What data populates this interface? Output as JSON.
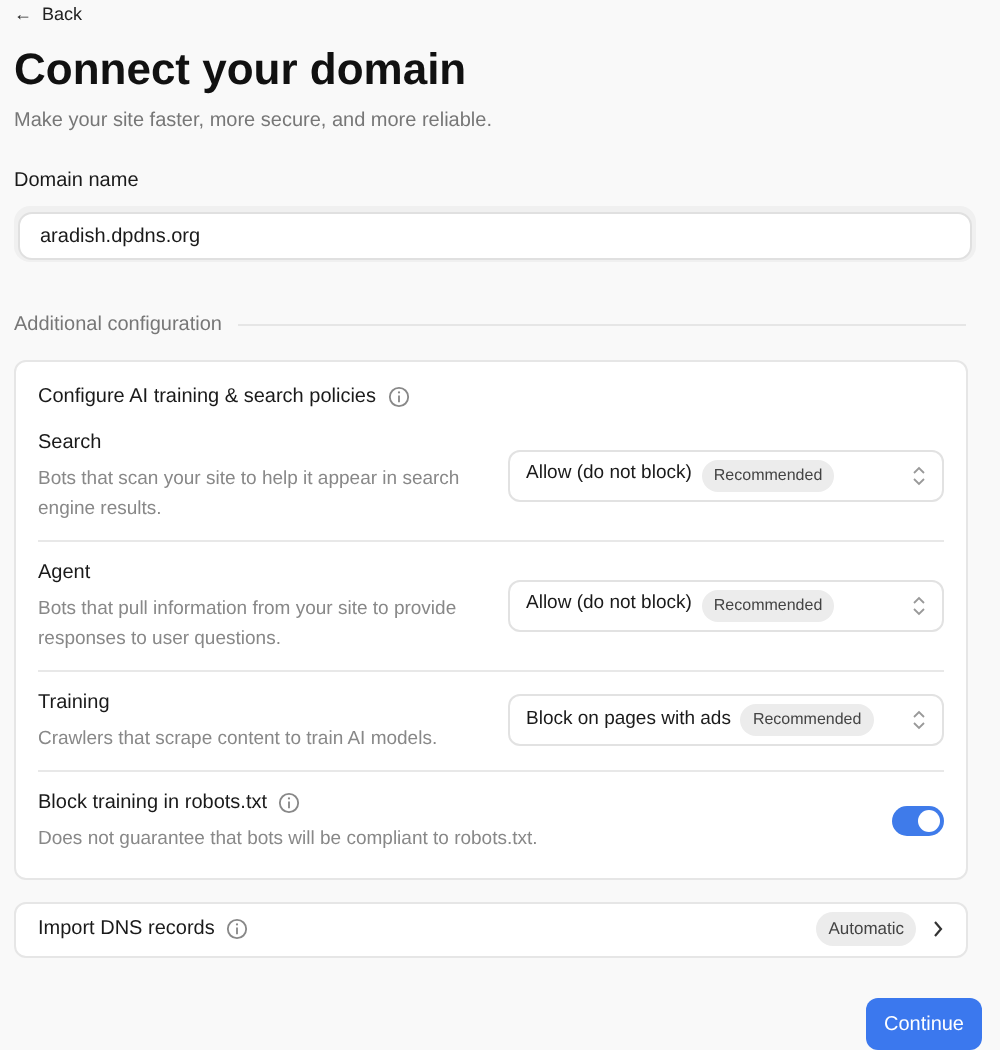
{
  "back_link": {
    "icon": "←",
    "label": "Back"
  },
  "title": "Connect your domain",
  "subtitle": "Make your site faster, more secure, and more reliable.",
  "domain_field": {
    "label": "Domain name",
    "value": "aradish.dpdns.org"
  },
  "section_heading": "Additional configuration",
  "policies": {
    "title": "Configure AI training & search policies",
    "rows": [
      {
        "kind": "select",
        "label": "Search",
        "description": "Bots that scan your site to help it appear in search engine results.",
        "value": "Allow (do not block)",
        "badge": "Recommended"
      },
      {
        "kind": "select",
        "label": "Agent",
        "description": "Bots that pull information from your site to provide responses to user questions.",
        "value": "Allow (do not block)",
        "badge": "Recommended"
      },
      {
        "kind": "select",
        "label": "Training",
        "description": "Crawlers that scrape content to train AI models.",
        "value": "Block on pages with ads",
        "badge": "Recommended"
      },
      {
        "kind": "toggle",
        "label": "Block training in robots.txt",
        "description": "Does not guarantee that bots will be compliant to robots.txt.",
        "on": true
      }
    ]
  },
  "dns_import": {
    "label": "Import DNS records",
    "badge": "Automatic"
  },
  "continue_button": "Continue"
}
